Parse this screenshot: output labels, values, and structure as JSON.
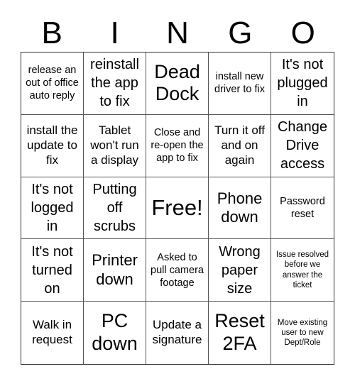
{
  "header": {
    "letters": [
      "B",
      "I",
      "N",
      "G",
      "O"
    ]
  },
  "board": {
    "cells": [
      {
        "text": "release an out of office auto reply",
        "size": "s"
      },
      {
        "text": "reinstall the app to fix",
        "size": "l"
      },
      {
        "text": "Dead Dock",
        "size": "xxl"
      },
      {
        "text": "install new driver to fix",
        "size": "s"
      },
      {
        "text": "It's not plugged in",
        "size": "l"
      },
      {
        "text": "install the update to fix",
        "size": "m"
      },
      {
        "text": "Tablet won't run a display",
        "size": "m"
      },
      {
        "text": "Close and re-open the app to fix",
        "size": "s"
      },
      {
        "text": "Turn it off and on again",
        "size": "m"
      },
      {
        "text": "Change Drive access",
        "size": "l"
      },
      {
        "text": "It's not logged in",
        "size": "l"
      },
      {
        "text": "Putting off scrubs",
        "size": "l"
      },
      {
        "text": "Free!",
        "size": "free"
      },
      {
        "text": "Phone down",
        "size": "xl"
      },
      {
        "text": "Password reset",
        "size": "s"
      },
      {
        "text": "It's not turned on",
        "size": "l"
      },
      {
        "text": "Printer down",
        "size": "xl"
      },
      {
        "text": "Asked to pull camera footage",
        "size": "s"
      },
      {
        "text": "Wrong paper size",
        "size": "l"
      },
      {
        "text": "Issue resolved before we answer the ticket",
        "size": "xs"
      },
      {
        "text": "Walk in request",
        "size": "m"
      },
      {
        "text": "PC down",
        "size": "xxl"
      },
      {
        "text": "Update a signature",
        "size": "m"
      },
      {
        "text": "Reset 2FA",
        "size": "xxl"
      },
      {
        "text": "Move existing user to new Dept/Role",
        "size": "xs"
      }
    ]
  }
}
